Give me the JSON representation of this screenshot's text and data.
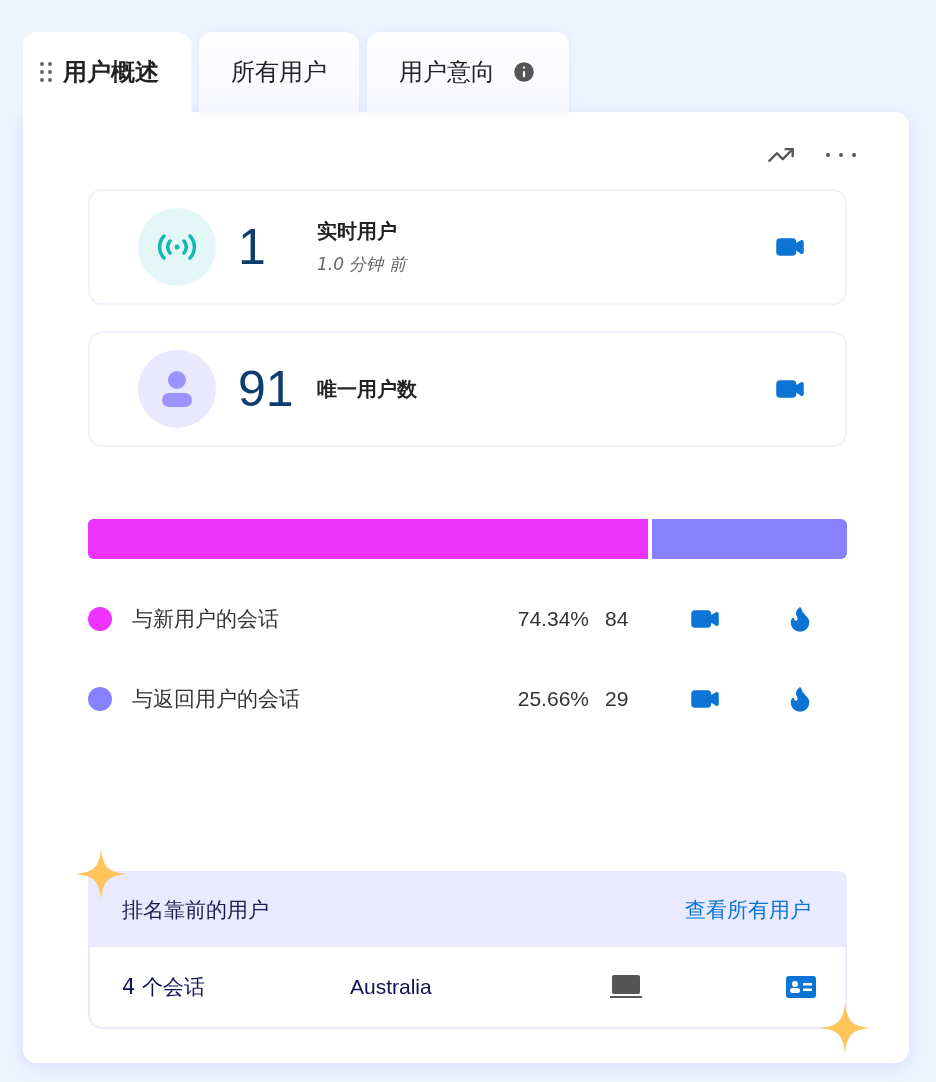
{
  "tabs": [
    {
      "label": "用户概述",
      "selected": true,
      "kind": "drag"
    },
    {
      "label": "所有用户",
      "selected": false,
      "kind": "plain"
    },
    {
      "label": "用户意向",
      "selected": false,
      "kind": "info"
    }
  ],
  "stats": [
    {
      "kind": "live",
      "value": "1",
      "label": "实时用户",
      "subtitle": "1.0 分钟 前"
    },
    {
      "kind": "person",
      "value": "91",
      "label": "唯一用户数"
    }
  ],
  "split": {
    "level": 0.7434
  },
  "segments": [
    {
      "label": "与新用户的会话",
      "percent": "74.34%",
      "count": "84",
      "color": "#ee33ff"
    },
    {
      "label": "与返回用户的会话",
      "percent": "25.66%",
      "count": "29",
      "color": "#8780ff"
    }
  ],
  "top_users": {
    "title": "排名靠前的用户",
    "link": "查看所有用户",
    "rows": [
      {
        "sessions": "4 个会话",
        "country": "Australia"
      }
    ]
  }
}
